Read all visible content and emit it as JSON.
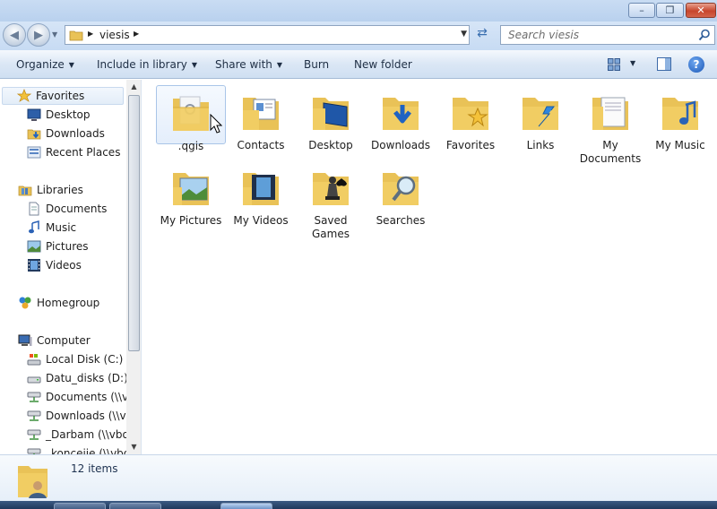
{
  "address": {
    "path": "viesis",
    "search_placeholder": "Search viesis"
  },
  "toolbar": {
    "organize": "Organize",
    "include_in_library": "Include in library",
    "share_with": "Share with",
    "burn": "Burn",
    "new_folder": "New folder"
  },
  "nav": {
    "favorites": "Favorites",
    "desktop": "Desktop",
    "downloads": "Downloads",
    "recent_places": "Recent Places",
    "libraries": "Libraries",
    "documents": "Documents",
    "music": "Music",
    "pictures": "Pictures",
    "videos": "Videos",
    "homegroup": "Homegroup",
    "computer": "Computer",
    "local_disk": "Local Disk (C:)",
    "datu_disks": "Datu_disks (D:)",
    "net_documents": "Documents (\\\\vb",
    "net_downloads": "Downloads (\\\\vb",
    "net_darbam": "_Darbam (\\\\vbox",
    "net_koncejie": "_koncejie (\\\\vbox"
  },
  "items": [
    {
      "name": ".qgis",
      "icon": "qgis-folder-icon"
    },
    {
      "name": "Contacts",
      "icon": "contacts-folder-icon"
    },
    {
      "name": "Desktop",
      "icon": "desktop-folder-icon"
    },
    {
      "name": "Downloads",
      "icon": "downloads-folder-icon"
    },
    {
      "name": "Favorites",
      "icon": "favorites-folder-icon"
    },
    {
      "name": "Links",
      "icon": "links-folder-icon"
    },
    {
      "name": "My Documents",
      "icon": "documents-folder-icon"
    },
    {
      "name": "My Music",
      "icon": "music-folder-icon"
    },
    {
      "name": "My Pictures",
      "icon": "pictures-folder-icon"
    },
    {
      "name": "My Videos",
      "icon": "videos-folder-icon"
    },
    {
      "name": "Saved Games",
      "icon": "saved-games-folder-icon"
    },
    {
      "name": "Searches",
      "icon": "searches-folder-icon"
    }
  ],
  "status": {
    "count": "12 items"
  },
  "colors": {
    "accent": "#3d6aa8",
    "folder": "#f1cd63",
    "selection": "#e4eefb"
  }
}
